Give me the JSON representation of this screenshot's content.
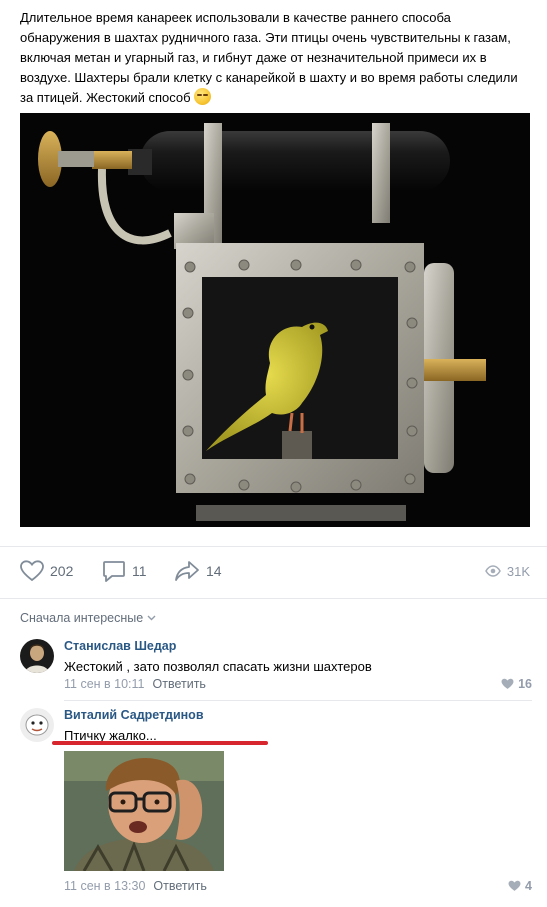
{
  "post": {
    "text": "Длительное время канареек использовали в качестве раннего способа обнаружения в шахтах рудничного газа. Эти птицы очень чувствительны к газам, включая метан и угарный газ, и гибнут даже от незначительной примеси их в воздухе. Шахтеры брали клетку с канарейкой в шахту и во время работы следили за птицей. Жестокий способ",
    "emoji": "flushed-face-emoji"
  },
  "photo": {
    "subject": "canary-cage-photo"
  },
  "actions": {
    "likes": "202",
    "comments": "11",
    "shares": "14",
    "views": "31K"
  },
  "sort_label": "Сначала интересные",
  "comments": [
    {
      "author": "Станислав Шедар",
      "text": "Жестокий , зато позволял спасать жизни шахтеров",
      "date": "11 сен в 10:11",
      "reply": "Ответить",
      "likes": "16"
    },
    {
      "author": "Виталий Садретдинов",
      "text": "Птичку жалко...",
      "date": "11 сен в 13:30",
      "reply": "Ответить",
      "likes": "4"
    }
  ],
  "colors": {
    "link": "#2a5885",
    "muted": "#939cab",
    "icon": "#626d7a",
    "underline": "#d7262d"
  }
}
